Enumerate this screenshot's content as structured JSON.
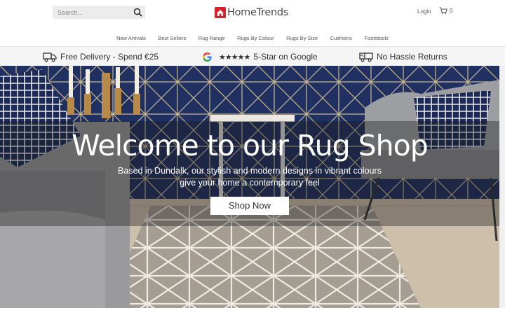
{
  "header": {
    "search_placeholder": "Search...",
    "brand": "HomeTrends",
    "login_label": "Login",
    "cart_count": "0",
    "icons": [
      "search-icon",
      "logo-icon",
      "cart-icon"
    ]
  },
  "nav": {
    "items": [
      {
        "label": "New Arrivals"
      },
      {
        "label": "Best Sellers"
      },
      {
        "label": "Rug Range"
      },
      {
        "label": "Rugs By Colour"
      },
      {
        "label": "Rugs By Size"
      },
      {
        "label": "Cushions"
      },
      {
        "label": "Footstools"
      }
    ]
  },
  "usp": {
    "delivery": "Free Delivery - Spend €25",
    "stars": "★★★★★",
    "rating": "5-Star on Google",
    "returns": "No Hassle Returns",
    "icons": [
      "delivery-truck-icon",
      "google-icon",
      "returns-truck-icon"
    ]
  },
  "hero": {
    "title": "Welcome to our Rug Shop",
    "subtitle_line1": "Based in Dundalk, our stylish and modern designs in vibrant colours",
    "subtitle_line2": "give your home a contemporary feel",
    "cta_label": "Shop Now"
  },
  "colors": {
    "brand_red": "#d2232a",
    "wallpaper_navy": "#1f2f5c",
    "sofa_grey": "#9a9a9c"
  }
}
